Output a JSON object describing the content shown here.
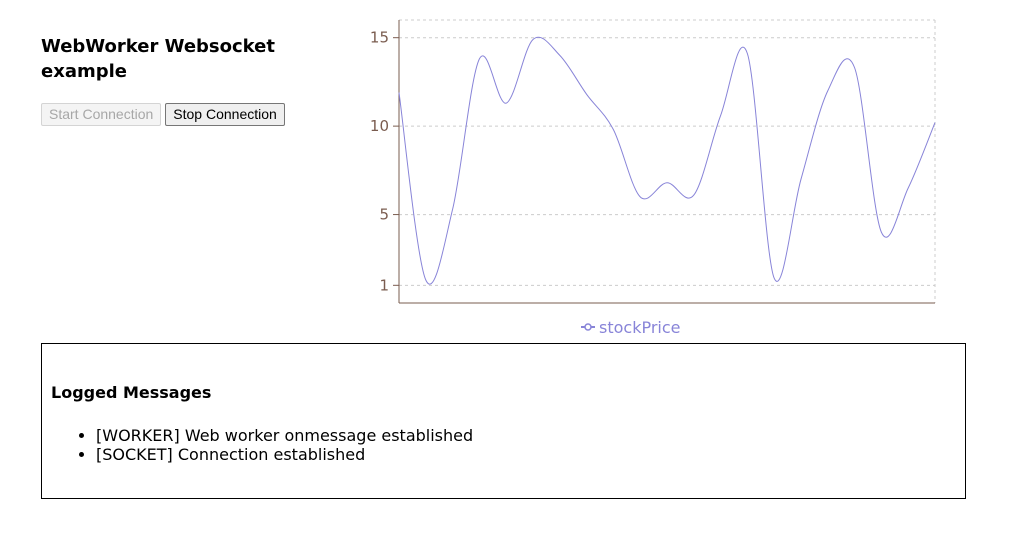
{
  "header": {
    "title": "WebWorker Websocket example"
  },
  "controls": {
    "start_label": "Start Connection",
    "start_disabled": true,
    "stop_label": "Stop Connection"
  },
  "chart_data": {
    "type": "line",
    "x": [
      0,
      1,
      2,
      3,
      4,
      5,
      6,
      7,
      8,
      9,
      10,
      11,
      12,
      13,
      14,
      15,
      16,
      17,
      18,
      19,
      20
    ],
    "series": [
      {
        "name": "stockPrice",
        "color": "#8884d8",
        "values": [
          11.9,
          1.3,
          5.3,
          13.8,
          11.3,
          14.9,
          14.0,
          11.8,
          9.8,
          6.0,
          6.8,
          6.1,
          10.6,
          14.1,
          1.4,
          7.0,
          12.0,
          13.3,
          4.0,
          6.5,
          10.2
        ]
      }
    ],
    "yticks": [
      1,
      5,
      10,
      15
    ],
    "ylim": [
      0,
      16
    ],
    "grid": true,
    "legend": "bottom-center",
    "axis_color": "#7a5c4f"
  },
  "log": {
    "title": "Logged Messages",
    "messages": [
      "[WORKER] Web worker onmessage established",
      "[SOCKET] Connection established"
    ]
  }
}
